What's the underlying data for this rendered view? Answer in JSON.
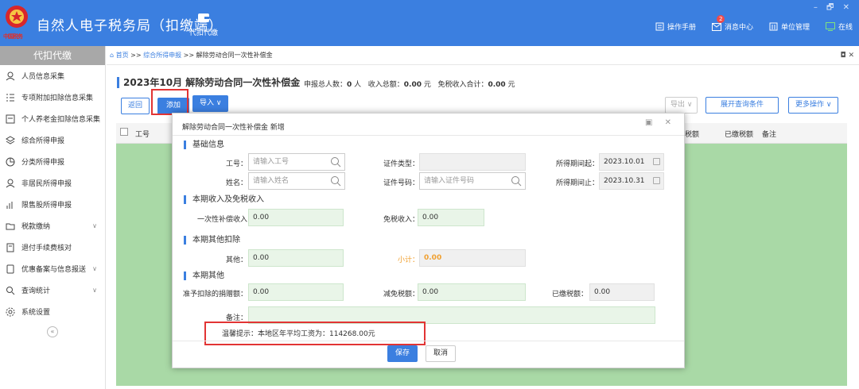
{
  "app": {
    "title": "自然人电子税务局（扣缴端）",
    "emblem_text": "中国税务",
    "window_controls": "– 🗗 ✕"
  },
  "topnav": {
    "label": "代扣代缴"
  },
  "topright": [
    {
      "label": "操作手册",
      "icon": "book-icon"
    },
    {
      "label": "消息中心",
      "icon": "mail-icon",
      "badge": "2"
    },
    {
      "label": "单位管理",
      "icon": "building-icon"
    },
    {
      "label": "在线",
      "icon": "monitor-icon"
    }
  ],
  "sidebar": {
    "title": "代扣代缴",
    "items": [
      {
        "label": "人员信息采集",
        "icon": "person-icon"
      },
      {
        "label": "专项附加扣除信息采集",
        "icon": "list-icon"
      },
      {
        "label": "个人养老金扣除信息采集",
        "icon": "card-icon"
      },
      {
        "label": "综合所得申报",
        "icon": "layers-icon"
      },
      {
        "label": "分类所得申报",
        "icon": "pie-icon"
      },
      {
        "label": "非居民所得申报",
        "icon": "user-icon"
      },
      {
        "label": "限售股所得申报",
        "icon": "bar-icon"
      },
      {
        "label": "税款缴纳",
        "icon": "folder-icon",
        "chevron": "∨"
      },
      {
        "label": "退付手续费核对",
        "icon": "doc-icon"
      },
      {
        "label": "优惠备案与信息报送",
        "icon": "file-icon",
        "chevron": "∨"
      },
      {
        "label": "查询统计",
        "icon": "query-icon",
        "chevron": "∨"
      },
      {
        "label": "系统设置",
        "icon": "gear-icon"
      }
    ],
    "collapse": "«"
  },
  "breadcrumb": {
    "home": "首页",
    "mid": "综合所得申报",
    "current": "解除劳动合同一次性补偿金",
    "sep": ">>",
    "close_controls": "◘ ✕"
  },
  "header": {
    "title": "2023年10月 解除劳动合同一次性补偿金"
  },
  "summary": {
    "count_label": "申报总人数：",
    "count": "0",
    "count_unit": " 人",
    "income_label": "收入总额：",
    "income": "0.00",
    "income_unit": " 元",
    "exempt_label": "免税收入合计：",
    "exempt": "0.00",
    "exempt_unit": " 元"
  },
  "toolbar": {
    "back": "返回",
    "add": "添加",
    "import": "导入 ∨",
    "export": "导出 ∨",
    "expand": "展开查询条件",
    "more": "更多操作 ∨"
  },
  "table": {
    "col_id": "工号",
    "col_tax": "税额",
    "col_paid": "已缴税额",
    "col_note": "备注"
  },
  "modal": {
    "title": "解除劳动合同一次性补偿金 新增",
    "controls": "▣ ✕",
    "sec_basic": "基础信息",
    "sec_income": "本期收入及免税收入",
    "sec_other_deduct": "本期其他扣除",
    "sec_other": "本期其他",
    "fields": {
      "id_label": "工号：",
      "id_placeholder": "请输入工号",
      "name_label": "姓名：",
      "name_placeholder": "请输入姓名",
      "cert_type_label": "证件类型：",
      "cert_no_label": "证件号码：",
      "cert_no_placeholder": "请输入证件号码",
      "period_start_label": "所得期间起：",
      "period_start": "2023.10.01",
      "period_end_label": "所得期间止：",
      "period_end": "2023.10.31",
      "comp_label": "一次性补偿收入",
      "comp": "0.00",
      "exempt_label": "免税收入：",
      "exempt": "0.00",
      "other_label": "其他：",
      "other": "0.00",
      "subtotal_label": "小计：",
      "subtotal": "0.00",
      "donation_label": "准予扣除的捐赠额：",
      "donation": "0.00",
      "reduction_label": "减免税额：",
      "reduction": "0.00",
      "paid_label": "已缴税额：",
      "paid": "0.00",
      "note_label": "备注："
    },
    "tip": "温馨提示：本地区年平均工资为：114268.00元",
    "save": "保存",
    "cancel": "取消"
  },
  "colors": {
    "accent": "#3b7fe0",
    "highlight": "#e23434",
    "table_fill": "#a9d9a6"
  }
}
